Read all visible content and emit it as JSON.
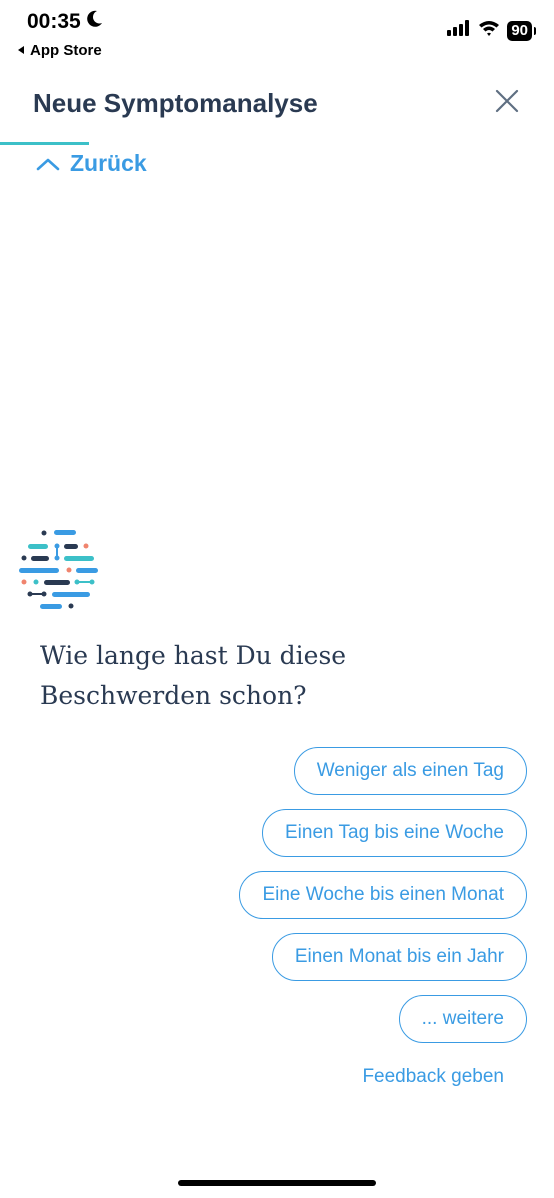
{
  "status_bar": {
    "time": "00:35",
    "back_label": "App Store",
    "battery": "90"
  },
  "header": {
    "title": "Neue Symptomanalyse",
    "progress": 0.16,
    "back_label": "Zurück"
  },
  "question": {
    "text": "Wie lange hast Du diese Beschwerden schon?"
  },
  "answers": [
    "Weniger als einen Tag",
    "Einen Tag bis eine Woche",
    "Eine Woche bis einen Monat",
    "Einen Monat bis ein Jahr",
    "... weitere"
  ],
  "feedback_label": "Feedback geben",
  "colors": {
    "accent": "#3a9be3",
    "teal": "#3cc0c8",
    "navy": "#2a3a52",
    "salmon": "#f0846e"
  }
}
